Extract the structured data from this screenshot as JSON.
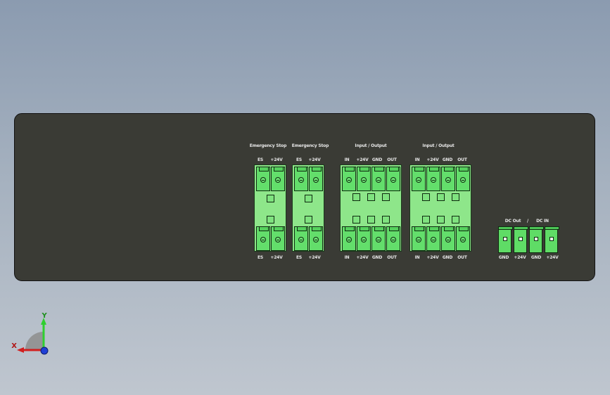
{
  "connectors": {
    "emergency1": {
      "title": "Emergency Stop",
      "top_pins": [
        "ES",
        "+24V"
      ],
      "bottom_pins": [
        "ES",
        "+24V"
      ]
    },
    "emergency2": {
      "title": "Emergency Stop",
      "top_pins": [
        "ES",
        "+24V"
      ],
      "bottom_pins": [
        "ES",
        "+24V"
      ]
    },
    "io1": {
      "title": "Input / Output",
      "top_pins": [
        "IN",
        "+24V",
        "GND",
        "OUT"
      ],
      "bottom_pins": [
        "IN",
        "+24V",
        "GND",
        "OUT"
      ]
    },
    "io2": {
      "title": "Input / Output",
      "top_pins": [
        "IN",
        "+24V",
        "GND",
        "OUT"
      ],
      "bottom_pins": [
        "IN",
        "+24V",
        "GND",
        "OUT"
      ]
    },
    "power": {
      "title_left": "DC Out",
      "separator": "/",
      "title_right": "DC IN",
      "pins": [
        "GND",
        "+24V",
        "GND",
        "+24V"
      ]
    }
  },
  "axis": {
    "x_label": "X",
    "y_label": "Y"
  },
  "colors": {
    "background": "#9aa8ba",
    "panel": "#3a3b35",
    "connector": "#63de6b",
    "axis_x": "#d11f1f",
    "axis_y": "#2fcf2f",
    "axis_z": "#1f3fd6"
  }
}
